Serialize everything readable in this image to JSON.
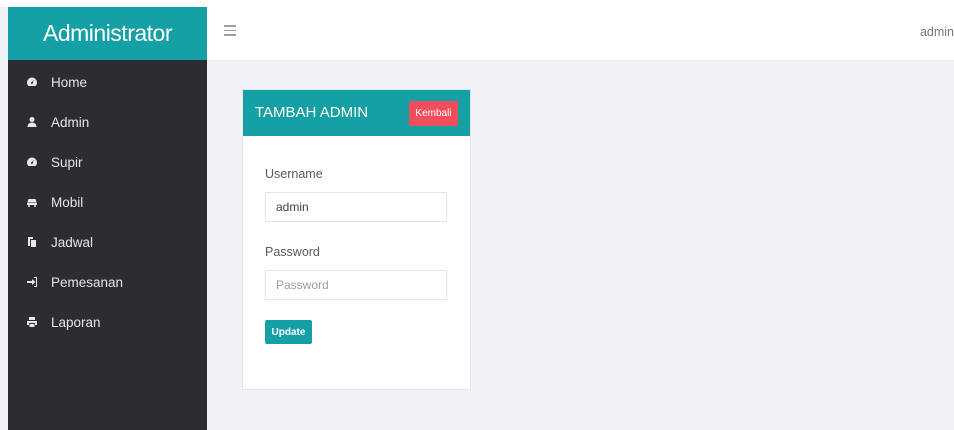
{
  "sidebar": {
    "brand": "Administrator",
    "items": [
      {
        "label": "Home",
        "icon": "dashboard-icon"
      },
      {
        "label": "Admin",
        "icon": "user-icon"
      },
      {
        "label": "Supir",
        "icon": "dashboard-icon"
      },
      {
        "label": "Mobil",
        "icon": "car-icon"
      },
      {
        "label": "Jadwal",
        "icon": "copy-icon"
      },
      {
        "label": "Pemesanan",
        "icon": "sign-in-icon"
      },
      {
        "label": "Laporan",
        "icon": "print-icon"
      }
    ]
  },
  "header": {
    "menu_icon": "hamburger-icon",
    "user": "admin"
  },
  "card": {
    "title": "TAMBAH ADMIN",
    "back_label": "Kembali",
    "username_label": "Username",
    "username_value": "admin",
    "password_label": "Password",
    "password_placeholder": "Password",
    "submit_label": "Update"
  },
  "colors": {
    "accent": "#15a0a6",
    "danger": "#ef4e5a",
    "sidebar_bg": "#2b2d33",
    "page_bg": "#f1f2f7"
  }
}
